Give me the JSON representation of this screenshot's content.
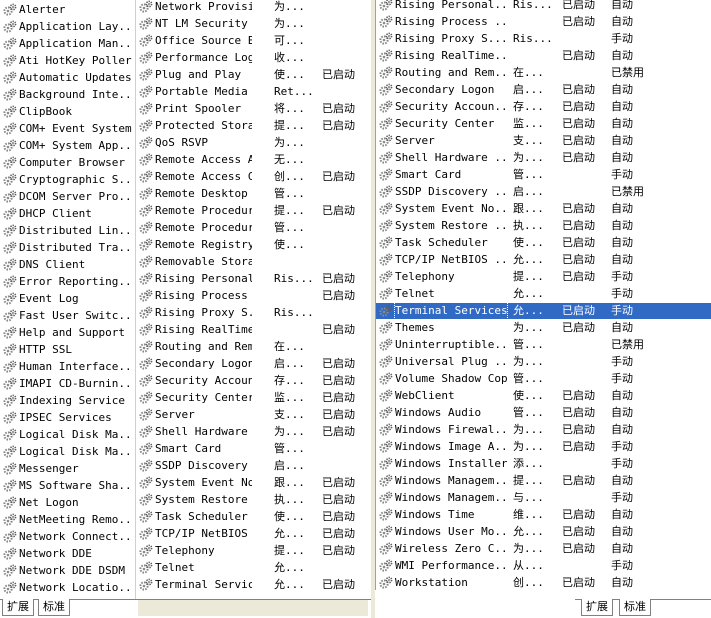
{
  "left_list": [
    "Alerter",
    "Application Lay...",
    "Application Man...",
    "Ati HotKey Poller",
    "Automatic Updates",
    "Background Inte...",
    "ClipBook",
    "COM+ Event System",
    "COM+ System App...",
    "Computer Browser",
    "Cryptographic S...",
    "DCOM Server Pro...",
    "DHCP Client",
    "Distributed Lin...",
    "Distributed Tra...",
    "DNS Client",
    "Error Reporting...",
    "Event Log",
    "Fast User Switc...",
    "Help and Support",
    "HTTP SSL",
    "Human Interface...",
    "IMAPI CD-Burnin...",
    "Indexing Service",
    "IPSEC Services",
    "Logical Disk Ma...",
    "Logical Disk Ma...",
    "Messenger",
    "MS Software Sha...",
    "Net Logon",
    "NetMeeting Remo...",
    "Network Connect...",
    "Network DDE",
    "Network DDE DSDM",
    "Network Locatio..."
  ],
  "middle_list": [
    {
      "name": "Network Provisi...",
      "desc": "为...",
      "status": "",
      "startup": ""
    },
    {
      "name": "NT LM Security ...",
      "desc": "为...",
      "status": "",
      "startup": ""
    },
    {
      "name": "Office Source E...",
      "desc": "可...",
      "status": "",
      "startup": ""
    },
    {
      "name": "Performance Log...",
      "desc": "收...",
      "status": "",
      "startup": ""
    },
    {
      "name": "Plug and Play",
      "desc": "使...",
      "status": "已启动",
      "startup": ""
    },
    {
      "name": "Portable Media ...",
      "desc": "Ret...",
      "status": "",
      "startup": ""
    },
    {
      "name": "Print Spooler",
      "desc": "将...",
      "status": "已启动",
      "startup": ""
    },
    {
      "name": "Protected Storage",
      "desc": "提...",
      "status": "已启动",
      "startup": ""
    },
    {
      "name": "QoS RSVP",
      "desc": "为...",
      "status": "",
      "startup": ""
    },
    {
      "name": "Remote Access A...",
      "desc": "无...",
      "status": "",
      "startup": ""
    },
    {
      "name": "Remote Access C...",
      "desc": "创...",
      "status": "已启动",
      "startup": ""
    },
    {
      "name": "Remote Desktop ...",
      "desc": "管...",
      "status": "",
      "startup": ""
    },
    {
      "name": "Remote Procedur...",
      "desc": "提...",
      "status": "已启动",
      "startup": ""
    },
    {
      "name": "Remote Procedur...",
      "desc": "管...",
      "status": "",
      "startup": ""
    },
    {
      "name": "Remote Registry",
      "desc": "使...",
      "status": "",
      "startup": ""
    },
    {
      "name": "Removable Storage",
      "desc": "",
      "status": "",
      "startup": ""
    },
    {
      "name": "Rising Personal...",
      "desc": "Ris...",
      "status": "已启动",
      "startup": ""
    },
    {
      "name": "Rising Process ...",
      "desc": "",
      "status": "已启动",
      "startup": ""
    },
    {
      "name": "Rising Proxy  S...",
      "desc": "Ris...",
      "status": "",
      "startup": ""
    },
    {
      "name": "Rising RealTime...",
      "desc": "",
      "status": "已启动",
      "startup": ""
    },
    {
      "name": "Routing and Rem...",
      "desc": "在...",
      "status": "",
      "startup": ""
    },
    {
      "name": "Secondary Logon",
      "desc": "启...",
      "status": "已启动",
      "startup": ""
    },
    {
      "name": "Security Accoun...",
      "desc": "存...",
      "status": "已启动",
      "startup": ""
    },
    {
      "name": "Security Center",
      "desc": "监...",
      "status": "已启动",
      "startup": ""
    },
    {
      "name": "Server",
      "desc": "支...",
      "status": "已启动",
      "startup": ""
    },
    {
      "name": "Shell Hardware ...",
      "desc": "为...",
      "status": "已启动",
      "startup": ""
    },
    {
      "name": "Smart Card",
      "desc": "管...",
      "status": "",
      "startup": ""
    },
    {
      "name": "SSDP Discovery ...",
      "desc": "启...",
      "status": "",
      "startup": ""
    },
    {
      "name": "System Event No...",
      "desc": "跟...",
      "status": "已启动",
      "startup": ""
    },
    {
      "name": "System Restore ...",
      "desc": "执...",
      "status": "已启动",
      "startup": ""
    },
    {
      "name": "Task Scheduler",
      "desc": "使...",
      "status": "已启动",
      "startup": ""
    },
    {
      "name": "TCP/IP NetBIOS ...",
      "desc": "允...",
      "status": "已启动",
      "startup": ""
    },
    {
      "name": "Telephony",
      "desc": "提...",
      "status": "已启动",
      "startup": ""
    },
    {
      "name": "Telnet",
      "desc": "允...",
      "status": "",
      "startup": ""
    },
    {
      "name": "Terminal Services",
      "desc": "允...",
      "status": "已启动",
      "startup": ""
    }
  ],
  "right_list": [
    {
      "name": "Rising Personal...",
      "desc": "Ris...",
      "status": "已启动",
      "startup": "自动"
    },
    {
      "name": "Rising Process ...",
      "desc": "",
      "status": "已启动",
      "startup": "自动"
    },
    {
      "name": "Rising Proxy  S...",
      "desc": "Ris...",
      "status": "",
      "startup": "手动"
    },
    {
      "name": "Rising RealTime...",
      "desc": "",
      "status": "已启动",
      "startup": "自动"
    },
    {
      "name": "Routing and Rem...",
      "desc": "在...",
      "status": "",
      "startup": "已禁用"
    },
    {
      "name": "Secondary Logon",
      "desc": "启...",
      "status": "已启动",
      "startup": "自动"
    },
    {
      "name": "Security Accoun...",
      "desc": "存...",
      "status": "已启动",
      "startup": "自动"
    },
    {
      "name": "Security Center",
      "desc": "监...",
      "status": "已启动",
      "startup": "自动"
    },
    {
      "name": "Server",
      "desc": "支...",
      "status": "已启动",
      "startup": "自动"
    },
    {
      "name": "Shell Hardware ...",
      "desc": "为...",
      "status": "已启动",
      "startup": "自动"
    },
    {
      "name": "Smart Card",
      "desc": "管...",
      "status": "",
      "startup": "手动"
    },
    {
      "name": "SSDP Discovery ...",
      "desc": "启...",
      "status": "",
      "startup": "已禁用"
    },
    {
      "name": "System Event No...",
      "desc": "跟...",
      "status": "已启动",
      "startup": "自动"
    },
    {
      "name": "System Restore ...",
      "desc": "执...",
      "status": "已启动",
      "startup": "自动"
    },
    {
      "name": "Task Scheduler",
      "desc": "使...",
      "status": "已启动",
      "startup": "自动"
    },
    {
      "name": "TCP/IP NetBIOS ...",
      "desc": "允...",
      "status": "已启动",
      "startup": "自动"
    },
    {
      "name": "Telephony",
      "desc": "提...",
      "status": "已启动",
      "startup": "手动"
    },
    {
      "name": "Telnet",
      "desc": "允...",
      "status": "",
      "startup": "手动"
    },
    {
      "name": "Terminal Services",
      "desc": "允...",
      "status": "已启动",
      "startup": "手动",
      "selected": true
    },
    {
      "name": "Themes",
      "desc": "为...",
      "status": "已启动",
      "startup": "自动"
    },
    {
      "name": "Uninterruptible...",
      "desc": "管...",
      "status": "",
      "startup": "已禁用"
    },
    {
      "name": "Universal Plug ...",
      "desc": "为...",
      "status": "",
      "startup": "手动"
    },
    {
      "name": "Volume Shadow Copy",
      "desc": "管...",
      "status": "",
      "startup": "手动"
    },
    {
      "name": "WebClient",
      "desc": "使...",
      "status": "已启动",
      "startup": "自动"
    },
    {
      "name": "Windows Audio",
      "desc": "管...",
      "status": "已启动",
      "startup": "自动"
    },
    {
      "name": "Windows Firewal...",
      "desc": "为...",
      "status": "已启动",
      "startup": "自动"
    },
    {
      "name": "Windows Image A...",
      "desc": "为...",
      "status": "已启动",
      "startup": "手动"
    },
    {
      "name": "Windows Installer",
      "desc": "添...",
      "status": "",
      "startup": "手动"
    },
    {
      "name": "Windows Managem...",
      "desc": "提...",
      "status": "已启动",
      "startup": "自动"
    },
    {
      "name": "Windows Managem...",
      "desc": "与...",
      "status": "",
      "startup": "手动"
    },
    {
      "name": "Windows Time",
      "desc": "维...",
      "status": "已启动",
      "startup": "自动"
    },
    {
      "name": "Windows User Mo...",
      "desc": "允...",
      "status": "已启动",
      "startup": "自动"
    },
    {
      "name": "Wireless Zero C...",
      "desc": "为...",
      "status": "已启动",
      "startup": "自动"
    },
    {
      "name": "WMI Performance...",
      "desc": "从...",
      "status": "",
      "startup": "手动"
    },
    {
      "name": "Workstation",
      "desc": "创...",
      "status": "已启动",
      "startup": "自动"
    }
  ],
  "tabs": {
    "extended": "扩展",
    "standard": "标准"
  },
  "colors": {
    "selection": "#316ac5",
    "gear": "#8a8a8a"
  }
}
